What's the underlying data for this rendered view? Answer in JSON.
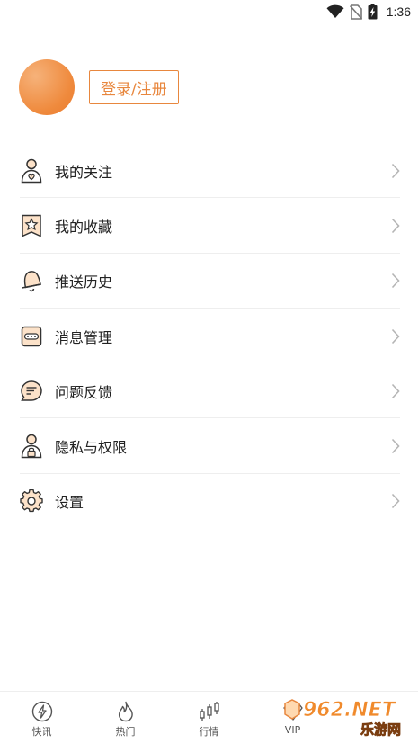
{
  "status_bar": {
    "time": "1:36",
    "icons": [
      "wifi-icon",
      "no-sim-icon",
      "battery-charging-icon"
    ]
  },
  "profile": {
    "login_label": "登录/注册"
  },
  "menu": {
    "items": [
      {
        "label": "我的关注",
        "icon": "person-heart-icon"
      },
      {
        "label": "我的收藏",
        "icon": "star-bookmark-icon"
      },
      {
        "label": "推送历史",
        "icon": "bell-icon"
      },
      {
        "label": "消息管理",
        "icon": "message-dots-icon"
      },
      {
        "label": "问题反馈",
        "icon": "feedback-bubble-icon"
      },
      {
        "label": "隐私与权限",
        "icon": "person-lock-icon"
      },
      {
        "label": "设置",
        "icon": "gear-icon"
      }
    ]
  },
  "bottom_nav": {
    "items": [
      {
        "label": "快讯",
        "icon": "lightning-icon"
      },
      {
        "label": "热门",
        "icon": "flame-icon"
      },
      {
        "label": "行情",
        "icon": "candlestick-icon"
      },
      {
        "label": "VIP",
        "icon": "vip-diamond-icon"
      },
      {
        "label": "",
        "icon": ""
      }
    ]
  },
  "watermark": {
    "brand": "962.NET",
    "subtitle": "乐游网"
  },
  "colors": {
    "accent": "#e8873e",
    "avatar": "#ef8a3d",
    "divider": "#eeeeee",
    "text": "#222222"
  }
}
